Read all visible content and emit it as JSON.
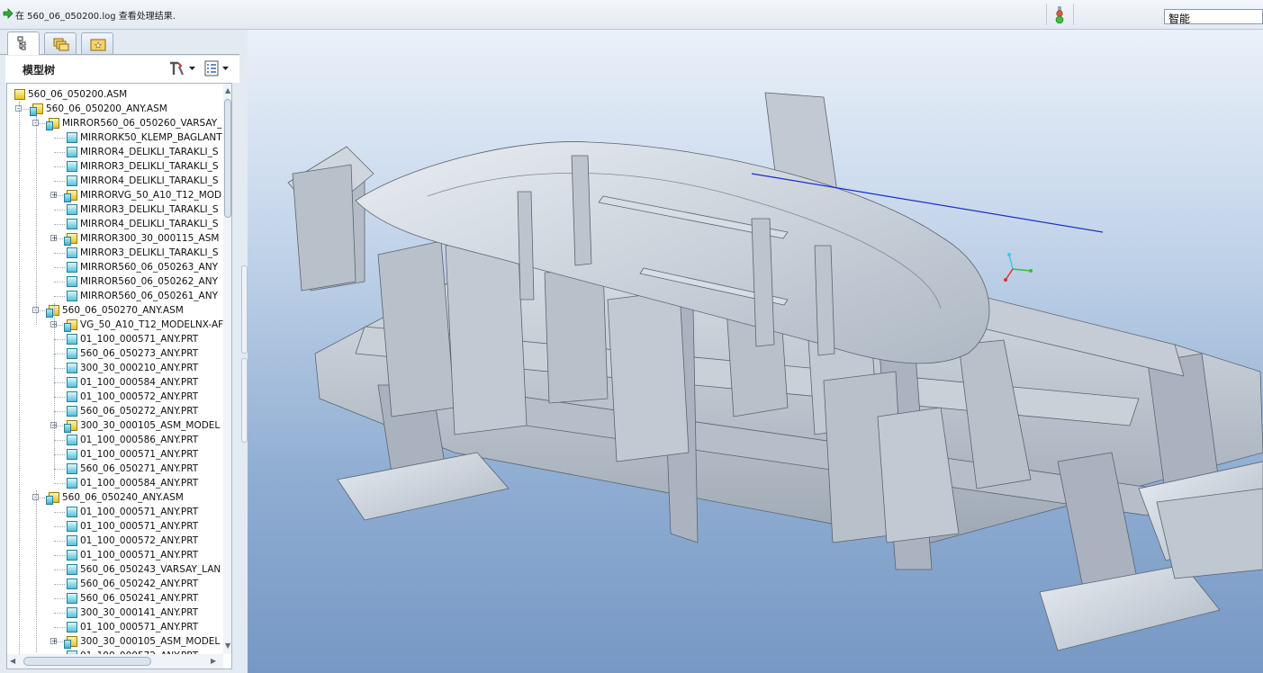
{
  "message_bar": {
    "message": "在 560_06_050200.log 查看处理结果.",
    "filter_value": "智能"
  },
  "left_panel": {
    "tabs": [
      "model-tree",
      "folder-browser",
      "favorites"
    ],
    "tree_title": "模型树"
  },
  "tree": {
    "rows": [
      {
        "label": "560_06_050200.ASM",
        "type": "top",
        "level": 0
      },
      {
        "label": "560_06_050200_ANY.ASM",
        "type": "asm",
        "level": 1,
        "expand": "-"
      },
      {
        "label": "MIRROR560_06_050260_VARSAY_",
        "type": "asm",
        "level": 2,
        "expand": "-"
      },
      {
        "label": "MIRRORK50_KLEMP_BAGLANT",
        "type": "prt",
        "level": 3
      },
      {
        "label": "MIRROR4_DELIKLI_TARAKLI_S",
        "type": "prt",
        "level": 3
      },
      {
        "label": "MIRROR3_DELIKLI_TARAKLI_S",
        "type": "prt",
        "level": 3
      },
      {
        "label": "MIRROR4_DELIKLI_TARAKLI_S",
        "type": "prt",
        "level": 3
      },
      {
        "label": "MIRRORVG_50_A10_T12_MOD",
        "type": "asm",
        "level": 3,
        "expand": "+"
      },
      {
        "label": "MIRROR3_DELIKLI_TARAKLI_S",
        "type": "prt",
        "level": 3
      },
      {
        "label": "MIRROR4_DELIKLI_TARAKLI_S",
        "type": "prt",
        "level": 3
      },
      {
        "label": "MIRROR300_30_000115_ASM",
        "type": "asm",
        "level": 3,
        "expand": "+"
      },
      {
        "label": "MIRROR3_DELIKLI_TARAKLI_S",
        "type": "prt",
        "level": 3
      },
      {
        "label": "MIRROR560_06_050263_ANY",
        "type": "prt",
        "level": 3
      },
      {
        "label": "MIRROR560_06_050262_ANY",
        "type": "prt",
        "level": 3
      },
      {
        "label": "MIRROR560_06_050261_ANY",
        "type": "prt",
        "level": 3
      },
      {
        "label": "560_06_050270_ANY.ASM",
        "type": "asm",
        "level": 2,
        "expand": "-"
      },
      {
        "label": "VG_50_A10_T12_MODELNX-AF",
        "type": "asm",
        "level": 3,
        "expand": "+"
      },
      {
        "label": "01_100_000571_ANY.PRT",
        "type": "prt",
        "level": 3
      },
      {
        "label": "560_06_050273_ANY.PRT",
        "type": "prt",
        "level": 3
      },
      {
        "label": "300_30_000210_ANY.PRT",
        "type": "prt",
        "level": 3
      },
      {
        "label": "01_100_000584_ANY.PRT",
        "type": "prt",
        "level": 3
      },
      {
        "label": "01_100_000572_ANY.PRT",
        "type": "prt",
        "level": 3
      },
      {
        "label": "560_06_050272_ANY.PRT",
        "type": "prt",
        "level": 3
      },
      {
        "label": "300_30_000105_ASM_MODEL",
        "type": "asm",
        "level": 3,
        "expand": "+"
      },
      {
        "label": "01_100_000586_ANY.PRT",
        "type": "prt",
        "level": 3
      },
      {
        "label": "01_100_000571_ANY.PRT",
        "type": "prt",
        "level": 3
      },
      {
        "label": "560_06_050271_ANY.PRT",
        "type": "prt",
        "level": 3
      },
      {
        "label": "01_100_000584_ANY.PRT",
        "type": "prt",
        "level": 3
      },
      {
        "label": "560_06_050240_ANY.ASM",
        "type": "asm",
        "level": 2,
        "expand": "-"
      },
      {
        "label": "01_100_000571_ANY.PRT",
        "type": "prt",
        "level": 3
      },
      {
        "label": "01_100_000571_ANY.PRT",
        "type": "prt",
        "level": 3
      },
      {
        "label": "01_100_000572_ANY.PRT",
        "type": "prt",
        "level": 3
      },
      {
        "label": "01_100_000571_ANY.PRT",
        "type": "prt",
        "level": 3
      },
      {
        "label": "560_06_050243_VARSAY_LAN",
        "type": "prt",
        "level": 3
      },
      {
        "label": "560_06_050242_ANY.PRT",
        "type": "prt",
        "level": 3
      },
      {
        "label": "560_06_050241_ANY.PRT",
        "type": "prt",
        "level": 3
      },
      {
        "label": "300_30_000141_ANY.PRT",
        "type": "prt",
        "level": 3
      },
      {
        "label": "01_100_000571_ANY.PRT",
        "type": "prt",
        "level": 3
      },
      {
        "label": "300_30_000105_ASM_MODEL",
        "type": "asm",
        "level": 3,
        "expand": "+"
      },
      {
        "label": "01_100_000572_ANY.PRT",
        "type": "prt",
        "level": 3
      }
    ]
  },
  "viewport": {
    "background_top": "#eaf1f9",
    "background_bottom": "#7798c5",
    "model_color": "#b9c1cb",
    "triad_colors": {
      "x": "#e03030",
      "y": "#30c030",
      "z": "#30d0e0"
    }
  }
}
